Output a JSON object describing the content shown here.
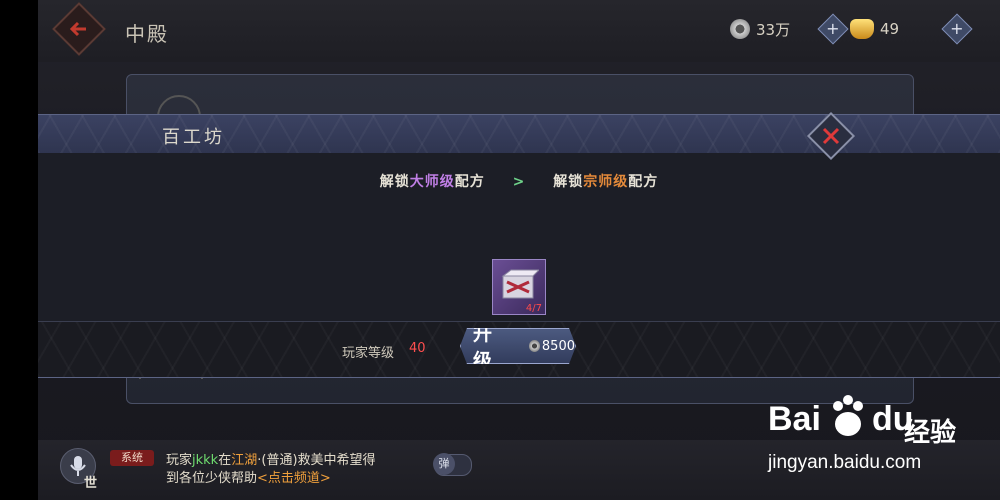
{
  "header": {
    "title": "中殿",
    "back_icon": "arrow-left-icon"
  },
  "resources": {
    "coin": {
      "value": "33万",
      "icon": "coin-icon"
    },
    "gold": {
      "value": "49",
      "icon": "gold-ingot-icon"
    }
  },
  "background_panel": {
    "title": "百工坊"
  },
  "dialog": {
    "title": "百工坊",
    "unlock_prefix_1": "解锁",
    "unlock_highlight_1": "大师级",
    "unlock_suffix_1": "配方",
    "arrow": ">",
    "unlock_prefix_2": "解锁",
    "unlock_highlight_2": "宗师级",
    "unlock_suffix_2": "配方",
    "item": {
      "count": "4/7",
      "icon": "material-crate-icon"
    },
    "level_label": "玩家等级",
    "level_value": "40",
    "upgrade_label": "升 级",
    "upgrade_cost": "8500"
  },
  "chat": {
    "channel": "世",
    "badge": "系统",
    "line1_a": "玩家",
    "line1_name": "jkkk",
    "line1_b": "在",
    "line1_place": "江湖",
    "line1_c": "·(普通)救美",
    "line1_d": "中希望得",
    "line2_a": "到各位少侠帮助",
    "line2_link": "<点击频道>",
    "toggle_label": "弹"
  },
  "watermark": {
    "brand_a": "Bai",
    "brand_b": "du",
    "brand_c": "经验",
    "url": "jingyan.baidu.com"
  },
  "colors": {
    "accent_purple": "#c07fe6",
    "accent_orange": "#e48a3a",
    "level_red": "#ff4f4f"
  }
}
